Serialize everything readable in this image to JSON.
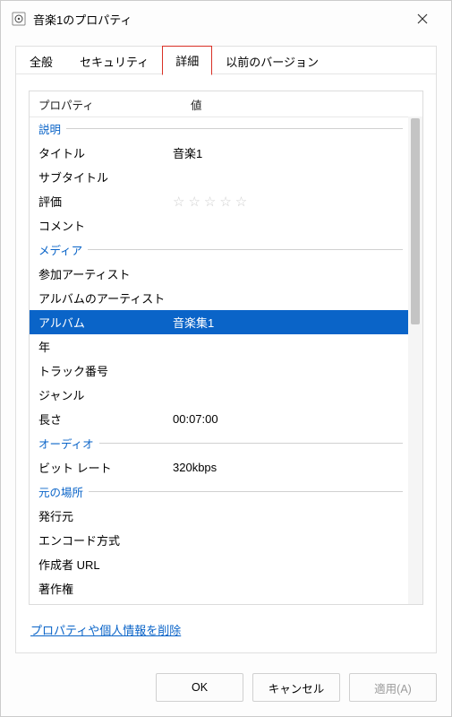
{
  "window": {
    "title": "音楽1のプロパティ"
  },
  "tabs": [
    {
      "label": "全般",
      "active": false
    },
    {
      "label": "セキュリティ",
      "active": false
    },
    {
      "label": "詳細",
      "active": true
    },
    {
      "label": "以前のバージョン",
      "active": false
    }
  ],
  "columns": {
    "property": "プロパティ",
    "value": "値"
  },
  "groups": {
    "description": "説明",
    "media": "メディア",
    "audio": "オーディオ",
    "origin": "元の場所"
  },
  "rows": {
    "title": {
      "label": "タイトル",
      "value": "音楽1"
    },
    "subtitle": {
      "label": "サブタイトル",
      "value": ""
    },
    "rating": {
      "label": "評価",
      "value": "☆☆☆☆☆"
    },
    "comment": {
      "label": "コメント",
      "value": ""
    },
    "artists": {
      "label": "参加アーティスト",
      "value": ""
    },
    "albumArtist": {
      "label": "アルバムのアーティスト",
      "value": ""
    },
    "album": {
      "label": "アルバム",
      "value": "音楽集1",
      "selected": true
    },
    "year": {
      "label": "年",
      "value": ""
    },
    "track": {
      "label": "トラック番号",
      "value": ""
    },
    "genre": {
      "label": "ジャンル",
      "value": ""
    },
    "length": {
      "label": "長さ",
      "value": "00:07:00"
    },
    "bitrate": {
      "label": "ビット レート",
      "value": "320kbps"
    },
    "publisher": {
      "label": "発行元",
      "value": ""
    },
    "encoding": {
      "label": "エンコード方式",
      "value": ""
    },
    "authorUrl": {
      "label": "作成者 URL",
      "value": ""
    },
    "copyright": {
      "label": "著作権",
      "value": ""
    }
  },
  "link": {
    "removeProps": "プロパティや個人情報を削除"
  },
  "buttons": {
    "ok": "OK",
    "cancel": "キャンセル",
    "apply": "適用(A)"
  }
}
